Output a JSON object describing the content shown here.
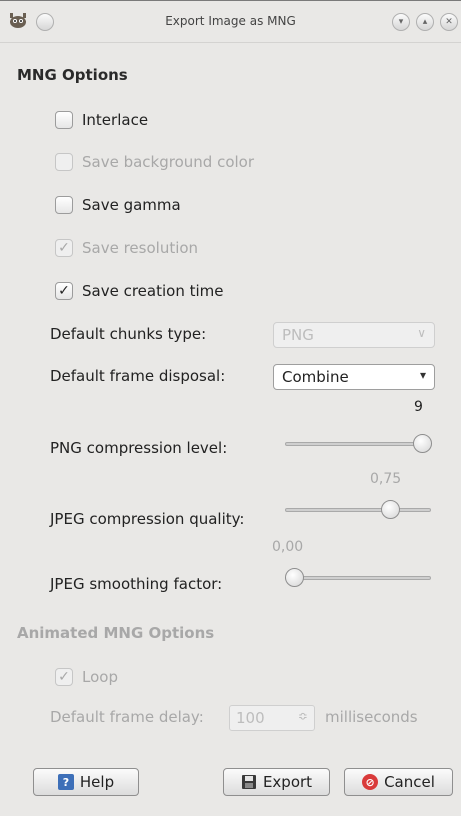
{
  "window": {
    "title": "Export Image as MNG"
  },
  "mng_options": {
    "heading": "MNG Options",
    "checkboxes": [
      {
        "label": "Interlace",
        "checked": false,
        "enabled": true
      },
      {
        "label": "Save background color",
        "checked": false,
        "enabled": false
      },
      {
        "label": "Save gamma",
        "checked": false,
        "enabled": true
      },
      {
        "label": "Save resolution",
        "checked": true,
        "enabled": false
      },
      {
        "label": "Save creation time",
        "checked": true,
        "enabled": true
      }
    ],
    "default_chunks_type": {
      "label": "Default chunks type:",
      "value": "PNG",
      "enabled": false
    },
    "default_frame_disposal": {
      "label": "Default frame disposal:",
      "value": "Combine",
      "enabled": true
    },
    "png_compression": {
      "label": "PNG compression level:",
      "value": "9",
      "fraction": 1.0,
      "enabled": true
    },
    "jpeg_quality": {
      "label": "JPEG compression quality:",
      "value": "0,75",
      "fraction": 0.75,
      "enabled": true
    },
    "jpeg_smoothing": {
      "label": "JPEG smoothing factor:",
      "value": "0,00",
      "fraction": 0.0,
      "enabled": true
    }
  },
  "animated_options": {
    "heading": "Animated MNG Options",
    "loop": {
      "label": "Loop",
      "checked": true,
      "enabled": false
    },
    "frame_delay": {
      "label": "Default frame delay:",
      "value": "100",
      "unit": "milliseconds",
      "enabled": false
    }
  },
  "buttons": {
    "help": "Help",
    "export": "Export",
    "cancel": "Cancel"
  },
  "colors": {
    "cancel_icon": "#d93a3a",
    "help_icon": "#3d6fb8"
  }
}
